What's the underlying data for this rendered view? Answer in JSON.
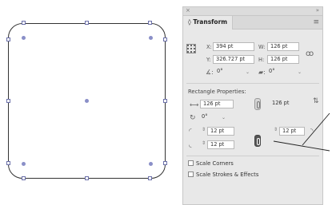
{
  "panel": {
    "close_glyph": "×",
    "collapse_glyph": "»",
    "tab": "◊ Transform",
    "menu_glyph": "≡"
  },
  "transform": {
    "x_label": "X:",
    "x": "394 pt",
    "w_label": "W:",
    "w": "126 pt",
    "y_label": "Y:",
    "y": "326.727 pt",
    "h_label": "H:",
    "h": "126 pt",
    "angle": "0°",
    "shear": "0°"
  },
  "rect": {
    "section": "Rectangle Properties:",
    "width": "126 pt",
    "height": "126 pt",
    "rotation": "0°",
    "corner_tl": "12 pt",
    "corner_tr": "12 pt",
    "corner_bl": "12 pt"
  },
  "options": {
    "scale_corners": "Scale Corners",
    "scale_strokes": "Scale Strokes & Effects"
  }
}
